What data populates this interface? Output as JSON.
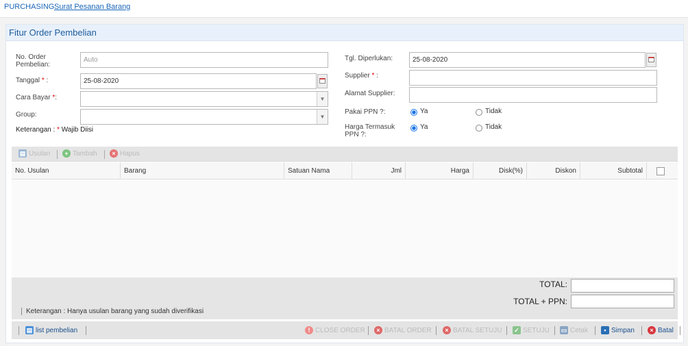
{
  "breadcrumb": {
    "module": "PURCHASING",
    "page": "Surat Pesanan Barang"
  },
  "panel": {
    "title": "Fitur Order Pembelian"
  },
  "form": {
    "no_order": {
      "label_line1": "No. Order",
      "label_line2": "Pembelian:",
      "placeholder": "Auto"
    },
    "tanggal": {
      "label": "Tanggal",
      "req": "*",
      "suffix": " :",
      "value": "25-08-2020"
    },
    "cara_bayar": {
      "label": "Cara Bayar",
      "req": "*",
      "suffix": ":",
      "value": ""
    },
    "group": {
      "label": "Group:",
      "value": ""
    },
    "keterangan": {
      "prefix": "Keterangan : ",
      "req": "*",
      "text": " Wajib Diisi"
    },
    "tgl_diperlukan": {
      "label": "Tgl. Diperlukan:",
      "value": "25-08-2020"
    },
    "supplier": {
      "label": "Supplier",
      "req": "*",
      "suffix": " :",
      "value": ""
    },
    "alamat_supplier": {
      "label": "Alamat Supplier:",
      "value": ""
    },
    "pakai_ppn": {
      "label": "Pakai PPN ?:",
      "options": [
        "Ya",
        "Tidak"
      ],
      "selected": "Ya"
    },
    "harga_termasuk_ppn": {
      "label_line1": "Harga Termasuk",
      "label_line2": "PPN ?:",
      "options": [
        "Ya",
        "Tidak"
      ],
      "selected": "Ya"
    }
  },
  "grid_toolbar": {
    "usulan": "Usulan",
    "tambah": "Tambah",
    "hapus": "Hapus"
  },
  "grid": {
    "columns": [
      "No. Usulan",
      "Barang",
      "Satuan Nama",
      "Jml",
      "Harga",
      "Disk(%)",
      "Diskon",
      "Subtotal"
    ],
    "rows": []
  },
  "totals": {
    "total_label": "TOTAL:",
    "total_value": "",
    "total_ppn_label": "TOTAL + PPN:",
    "total_ppn_value": ""
  },
  "note": "Keterangan : Hanya usulan barang yang sudah diverifikasi",
  "footer": {
    "list_pembelian": "list pembelian",
    "close_order": "CLOSE ORDER",
    "batal_order": "BATAL ORDER",
    "batal_setuju": "BATAL SETUJU",
    "setuju": "SETUJU",
    "cetak": "Cetak",
    "simpan": "Simpan",
    "batal": "Batal"
  },
  "colors": {
    "accent": "#1a66b8",
    "header_bg": "#e8f1fb",
    "danger": "#d9363e",
    "success": "#4caf50"
  }
}
